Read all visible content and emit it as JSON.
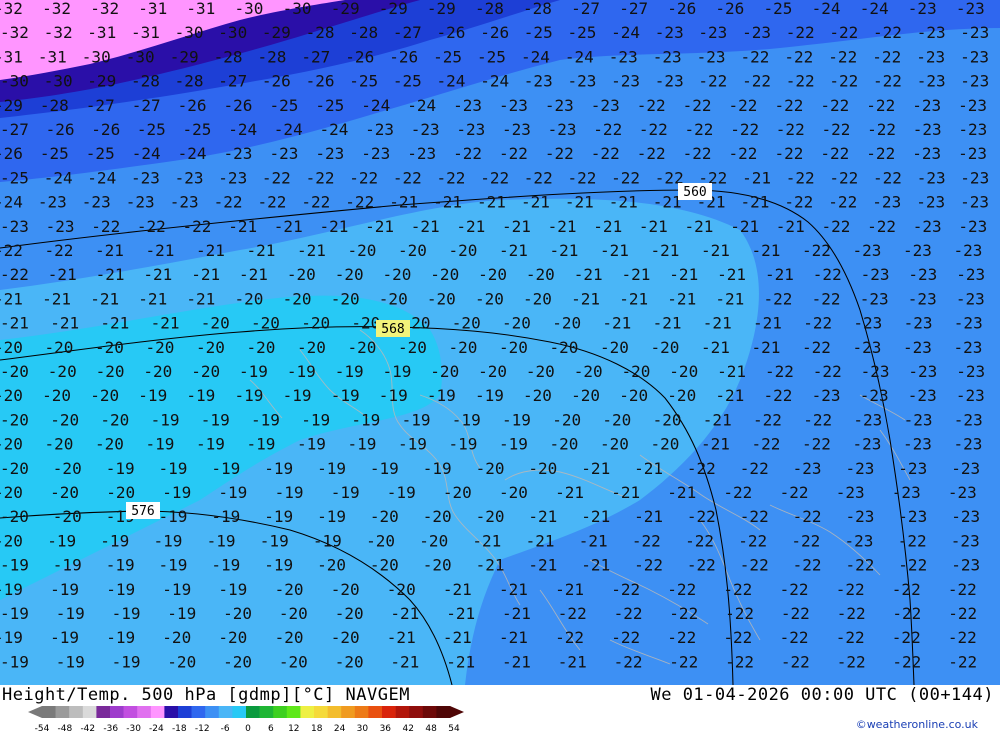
{
  "title": "Height/Temp. 500 hPa [gdmp][°C] NAVGEM",
  "valid_time": "We 01-04-2026 00:00 UTC (00+144)",
  "credit": "©weatheronline.co.uk",
  "colorbar": {
    "ticks": [
      "-54",
      "-48",
      "-42",
      "-36",
      "-30",
      "-24",
      "-18",
      "-12",
      "-6",
      "0",
      "6",
      "12",
      "18",
      "24",
      "30",
      "36",
      "42",
      "48",
      "54"
    ],
    "colors": [
      "#7a7a7a",
      "#9a9a9a",
      "#bdbdbd",
      "#dadada",
      "#7a2a9a",
      "#9e3ccc",
      "#c24fe0",
      "#e070ef",
      "#ff95ff",
      "#2a0fa8",
      "#1d3fd6",
      "#2f67ef",
      "#3d90f4",
      "#4ab6f7",
      "#27c9f5",
      "#0a9a3e",
      "#1fb634",
      "#3dd020",
      "#5fe81a",
      "#eef043",
      "#f5da3a",
      "#f3bd2d",
      "#f09b20",
      "#ed7a17",
      "#e9500f",
      "#d9230a",
      "#b2150a",
      "#8f0e0c",
      "#6d0908",
      "#4f0606"
    ]
  },
  "isohypses": [
    {
      "label": "560",
      "highlight": false
    },
    {
      "label": "568",
      "highlight": true
    },
    {
      "label": "576",
      "highlight": false
    }
  ],
  "temperature_rows": [
    {
      "row": 1,
      "values": [
        "-32",
        "-32",
        "-32",
        "-31",
        "-31",
        "-30",
        "-30",
        "-29",
        "-29",
        "-29",
        "-28",
        "-28",
        "-27",
        "-27",
        "-26",
        "-26",
        "-25",
        "-24",
        "-24",
        "-23",
        "-23"
      ]
    },
    {
      "row": 2,
      "values": [
        "-32",
        "-32",
        "-31",
        "-31",
        "-30",
        "-30",
        "-29",
        "-28",
        "-28",
        "-27",
        "-26",
        "-26",
        "-25",
        "-25",
        "-24",
        "-23",
        "-23",
        "-23",
        "-22",
        "-22",
        "-22",
        "-23",
        "-23"
      ]
    },
    {
      "row": 3,
      "values": [
        "-31",
        "-31",
        "-30",
        "-30",
        "-29",
        "-28",
        "-28",
        "-27",
        "-26",
        "-26",
        "-25",
        "-25",
        "-24",
        "-24",
        "-23",
        "-23",
        "-23",
        "-22",
        "-22",
        "-22",
        "-22",
        "-23",
        "-23"
      ]
    },
    {
      "row": 4,
      "values": [
        "-30",
        "-30",
        "-29",
        "-28",
        "-28",
        "-27",
        "-26",
        "-26",
        "-25",
        "-25",
        "-24",
        "-24",
        "-23",
        "-23",
        "-23",
        "-23",
        "-22",
        "-22",
        "-22",
        "-22",
        "-22",
        "-23",
        "-23"
      ]
    },
    {
      "row": 5,
      "values": [
        "-29",
        "-28",
        "-27",
        "-27",
        "-26",
        "-26",
        "-25",
        "-25",
        "-24",
        "-24",
        "-23",
        "-23",
        "-23",
        "-23",
        "-22",
        "-22",
        "-22",
        "-22",
        "-22",
        "-22",
        "-23",
        "-23"
      ]
    },
    {
      "row": 6,
      "values": [
        "-27",
        "-26",
        "-26",
        "-25",
        "-25",
        "-24",
        "-24",
        "-24",
        "-23",
        "-23",
        "-23",
        "-23",
        "-23",
        "-22",
        "-22",
        "-22",
        "-22",
        "-22",
        "-22",
        "-22",
        "-23",
        "-23"
      ]
    },
    {
      "row": 7,
      "values": [
        "-26",
        "-25",
        "-25",
        "-24",
        "-24",
        "-23",
        "-23",
        "-23",
        "-23",
        "-23",
        "-22",
        "-22",
        "-22",
        "-22",
        "-22",
        "-22",
        "-22",
        "-22",
        "-22",
        "-22",
        "-23",
        "-23"
      ]
    },
    {
      "row": 8,
      "values": [
        "-25",
        "-24",
        "-24",
        "-23",
        "-23",
        "-23",
        "-22",
        "-22",
        "-22",
        "-22",
        "-22",
        "-22",
        "-22",
        "-22",
        "-22",
        "-22",
        "-22",
        "-21",
        "-22",
        "-22",
        "-22",
        "-23",
        "-23"
      ]
    },
    {
      "row": 9,
      "values": [
        "-24",
        "-23",
        "-23",
        "-23",
        "-23",
        "-22",
        "-22",
        "-22",
        "-22",
        "-21",
        "-21",
        "-21",
        "-21",
        "-21",
        "-21",
        "-21",
        "-21",
        "-21",
        "-22",
        "-22",
        "-23",
        "-23",
        "-23"
      ]
    },
    {
      "row": 10,
      "values": [
        "-23",
        "-23",
        "-22",
        "-22",
        "-22",
        "-21",
        "-21",
        "-21",
        "-21",
        "-21",
        "-21",
        "-21",
        "-21",
        "-21",
        "-21",
        "-21",
        "-21",
        "-21",
        "-22",
        "-22",
        "-23",
        "-23"
      ]
    },
    {
      "row": 11,
      "values": [
        "-22",
        "-22",
        "-21",
        "-21",
        "-21",
        "-21",
        "-21",
        "-20",
        "-20",
        "-20",
        "-21",
        "-21",
        "-21",
        "-21",
        "-21",
        "-21",
        "-22",
        "-23",
        "-23",
        "-23"
      ]
    },
    {
      "row": 12,
      "values": [
        "-22",
        "-21",
        "-21",
        "-21",
        "-21",
        "-21",
        "-20",
        "-20",
        "-20",
        "-20",
        "-20",
        "-20",
        "-21",
        "-21",
        "-21",
        "-21",
        "-21",
        "-22",
        "-23",
        "-23",
        "-23"
      ]
    },
    {
      "row": 13,
      "values": [
        "-21",
        "-21",
        "-21",
        "-21",
        "-21",
        "-20",
        "-20",
        "-20",
        "-20",
        "-20",
        "-20",
        "-20",
        "-21",
        "-21",
        "-21",
        "-21",
        "-22",
        "-22",
        "-23",
        "-23",
        "-23"
      ]
    },
    {
      "row": 14,
      "values": [
        "-21",
        "-21",
        "-21",
        "-21",
        "-20",
        "-20",
        "-20",
        "-20",
        "-20",
        "-20",
        "-20",
        "-20",
        "-21",
        "-21",
        "-21",
        "-21",
        "-22",
        "-23",
        "-23",
        "-23"
      ]
    },
    {
      "row": 15,
      "values": [
        "-20",
        "-20",
        "-20",
        "-20",
        "-20",
        "-20",
        "-20",
        "-20",
        "-20",
        "-20",
        "-20",
        "-20",
        "-20",
        "-20",
        "-21",
        "-21",
        "-22",
        "-23",
        "-23",
        "-23"
      ]
    },
    {
      "row": 16,
      "values": [
        "-20",
        "-20",
        "-20",
        "-20",
        "-20",
        "-19",
        "-19",
        "-19",
        "-19",
        "-20",
        "-20",
        "-20",
        "-20",
        "-20",
        "-20",
        "-21",
        "-22",
        "-22",
        "-23",
        "-23",
        "-23"
      ]
    },
    {
      "row": 17,
      "values": [
        "-20",
        "-20",
        "-20",
        "-19",
        "-19",
        "-19",
        "-19",
        "-19",
        "-19",
        "-19",
        "-19",
        "-20",
        "-20",
        "-20",
        "-20",
        "-21",
        "-22",
        "-23",
        "-23",
        "-23",
        "-23"
      ]
    },
    {
      "row": 18,
      "values": [
        "-20",
        "-20",
        "-20",
        "-19",
        "-19",
        "-19",
        "-19",
        "-19",
        "-19",
        "-19",
        "-19",
        "-20",
        "-20",
        "-20",
        "-21",
        "-22",
        "-22",
        "-23",
        "-23",
        "-23"
      ]
    },
    {
      "row": 19,
      "values": [
        "-20",
        "-20",
        "-20",
        "-19",
        "-19",
        "-19",
        "-19",
        "-19",
        "-19",
        "-19",
        "-19",
        "-20",
        "-20",
        "-20",
        "-21",
        "-22",
        "-22",
        "-23",
        "-23",
        "-23"
      ]
    },
    {
      "row": 20,
      "values": [
        "-20",
        "-20",
        "-19",
        "-19",
        "-19",
        "-19",
        "-19",
        "-19",
        "-19",
        "-20",
        "-20",
        "-21",
        "-21",
        "-22",
        "-22",
        "-23",
        "-23",
        "-23",
        "-23"
      ]
    },
    {
      "row": 21,
      "values": [
        "-20",
        "-20",
        "-20",
        "-19",
        "-19",
        "-19",
        "-19",
        "-19",
        "-20",
        "-20",
        "-21",
        "-21",
        "-21",
        "-22",
        "-22",
        "-23",
        "-23",
        "-23"
      ]
    },
    {
      "row": 22,
      "values": [
        "-20",
        "-20",
        "-19",
        "-19",
        "-19",
        "-19",
        "-19",
        "-20",
        "-20",
        "-20",
        "-21",
        "-21",
        "-21",
        "-22",
        "-22",
        "-22",
        "-23",
        "-23",
        "-23"
      ]
    },
    {
      "row": 23,
      "values": [
        "-20",
        "-19",
        "-19",
        "-19",
        "-19",
        "-19",
        "-19",
        "-20",
        "-20",
        "-21",
        "-21",
        "-21",
        "-22",
        "-22",
        "-22",
        "-22",
        "-23",
        "-22",
        "-23"
      ]
    },
    {
      "row": 24,
      "values": [
        "-19",
        "-19",
        "-19",
        "-19",
        "-19",
        "-19",
        "-20",
        "-20",
        "-20",
        "-21",
        "-21",
        "-21",
        "-22",
        "-22",
        "-22",
        "-22",
        "-22",
        "-22",
        "-23"
      ]
    },
    {
      "row": 25,
      "values": [
        "-19",
        "-19",
        "-19",
        "-19",
        "-19",
        "-20",
        "-20",
        "-20",
        "-21",
        "-21",
        "-21",
        "-22",
        "-22",
        "-22",
        "-22",
        "-22",
        "-22",
        "-22"
      ]
    },
    {
      "row": 26,
      "values": [
        "-19",
        "-19",
        "-19",
        "-19",
        "-20",
        "-20",
        "-20",
        "-21",
        "-21",
        "-21",
        "-22",
        "-22",
        "-22",
        "-22",
        "-22",
        "-22",
        "-22",
        "-22"
      ]
    },
    {
      "row": 27,
      "values": [
        "-19",
        "-19",
        "-19",
        "-20",
        "-20",
        "-20",
        "-20",
        "-21",
        "-21",
        "-21",
        "-22",
        "-22",
        "-22",
        "-22",
        "-22",
        "-22",
        "-22",
        "-22"
      ]
    },
    {
      "row": 28,
      "values": [
        "-19",
        "-19",
        "-19",
        "-20",
        "-20",
        "-20",
        "-20",
        "-21",
        "-21",
        "-21",
        "-21",
        "-22",
        "-22",
        "-22",
        "-22",
        "-22",
        "-22",
        "-22"
      ]
    }
  ]
}
